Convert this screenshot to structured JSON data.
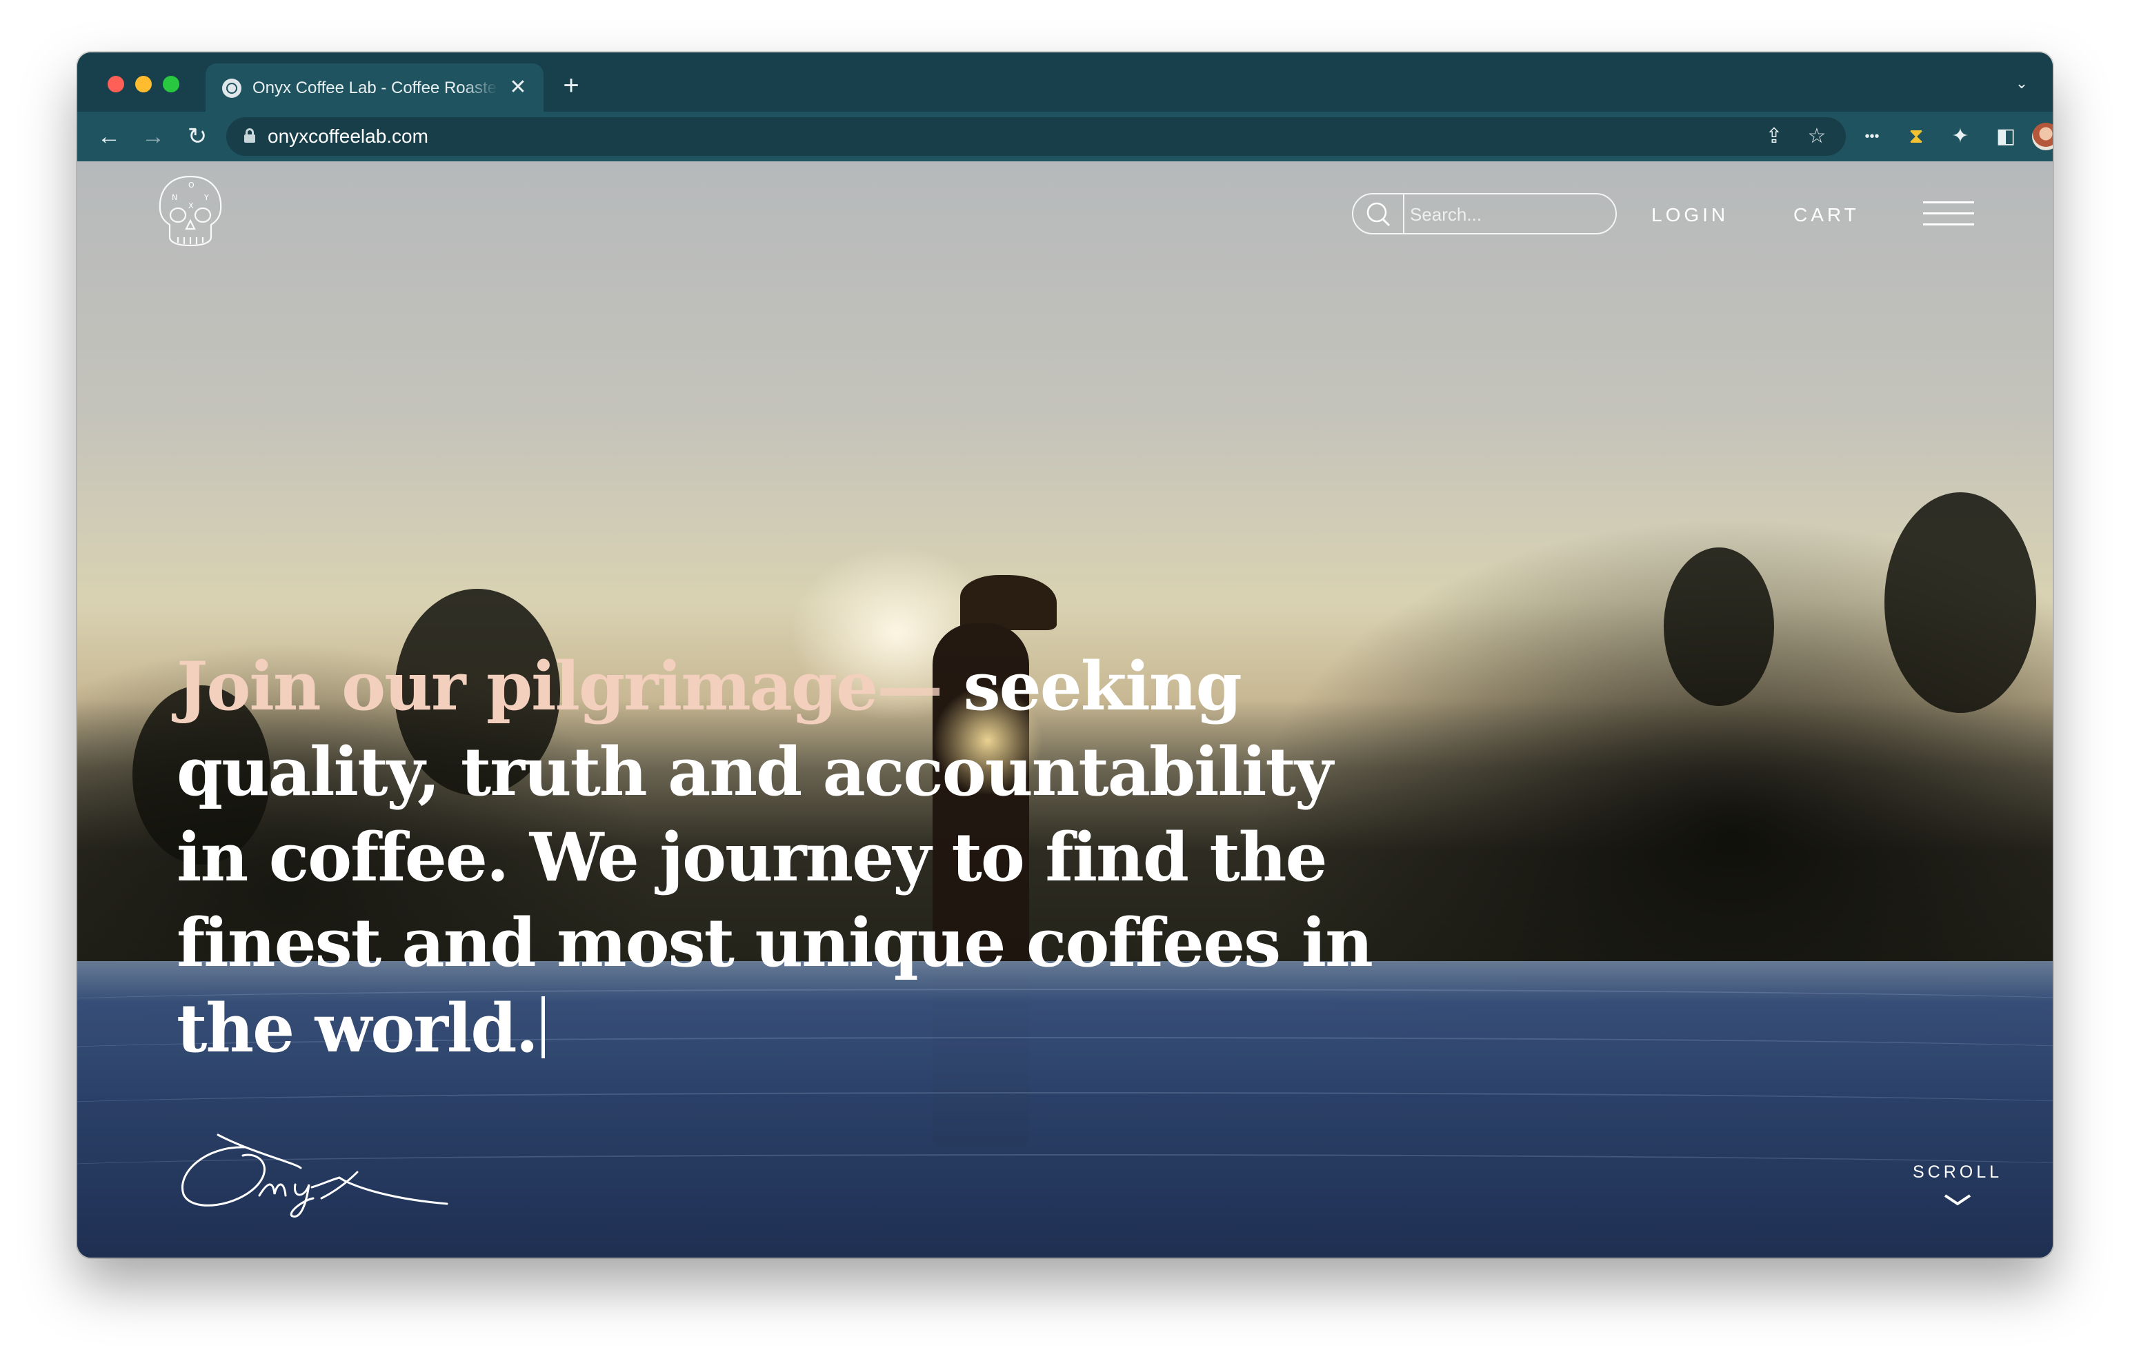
{
  "browser": {
    "tab_title": "Onyx Coffee Lab - Coffee Roasters",
    "tab_close": "✕",
    "new_tab": "+",
    "url": "onyxcoffeelab.com"
  },
  "site": {
    "search_placeholder": "Search...",
    "nav": {
      "login": "LOGIN",
      "cart": "CART"
    },
    "hero": {
      "accent": "Join our pilgrimage",
      "dash": "—",
      "body": " seeking quality, truth and accountability in coffee. We journey to find the finest and most unique coffees in the world."
    },
    "scroll_label": "SCROLL"
  },
  "icons": {
    "favicon": "globe-icon",
    "back": "arrow-left-icon",
    "forward": "arrow-right-icon",
    "reload": "reload-icon",
    "lock": "lock-icon",
    "share": "share-icon",
    "bookmark": "star-icon",
    "extensions": [
      "dots-extension-icon",
      "hourglass-extension-icon",
      "puzzle-icon",
      "side-panel-icon"
    ],
    "menu": "kebab-menu-icon",
    "logo": "skull-logo-icon",
    "search": "search-icon",
    "hamburger": "hamburger-menu-icon",
    "scroll": "chevron-down-icon"
  },
  "colors": {
    "chrome": "#1f5360",
    "titlebar": "#17404c",
    "hero_accent": "#f3cfbd"
  }
}
